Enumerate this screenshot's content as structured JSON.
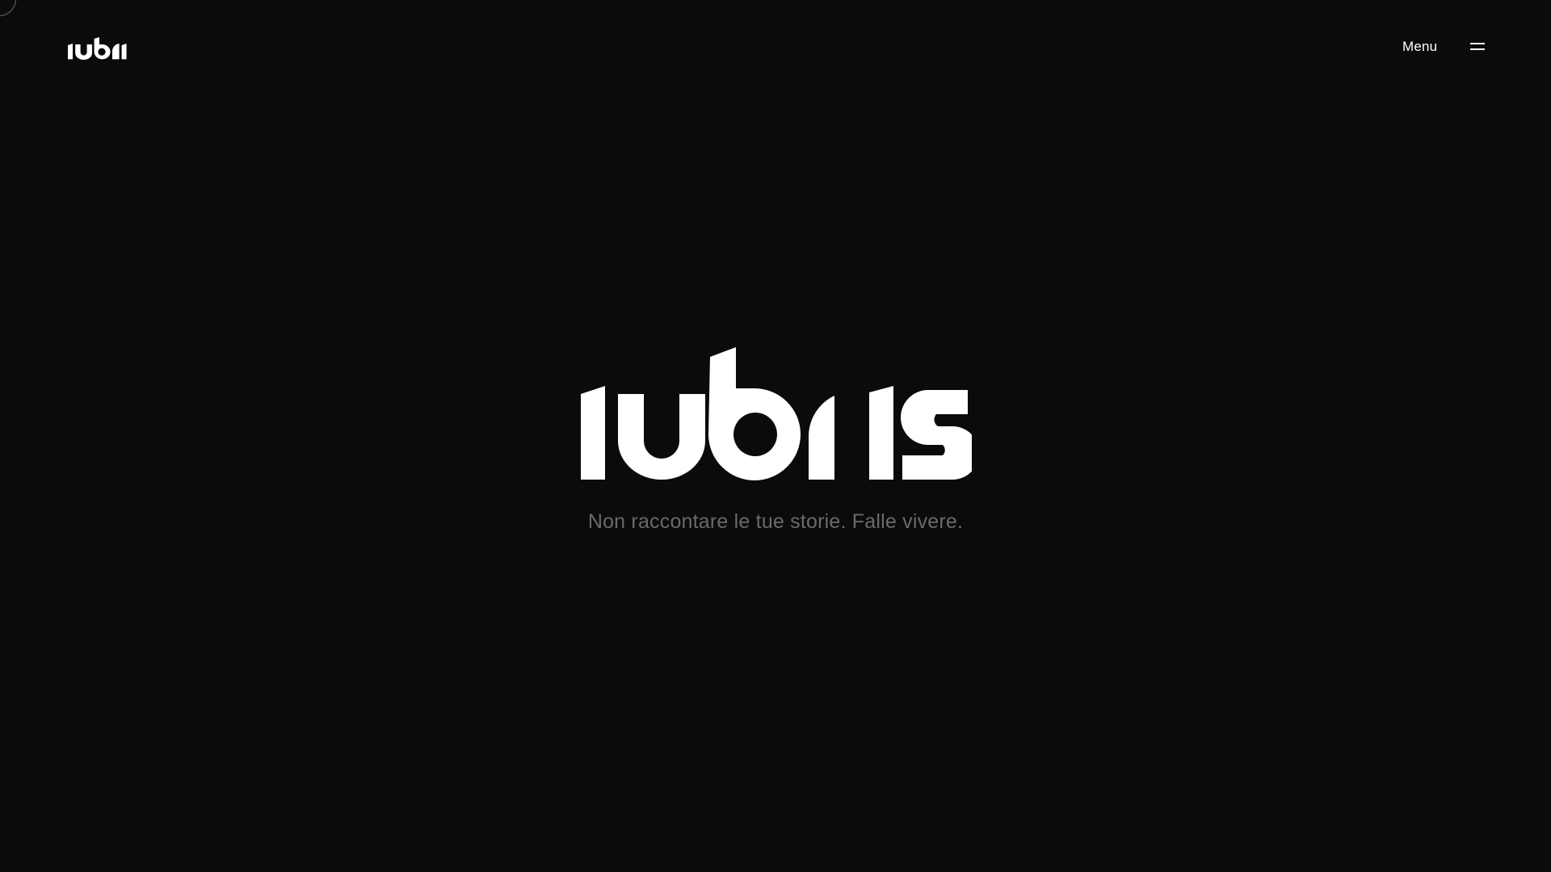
{
  "header": {
    "brand_name": "iubris",
    "menu_label": "Menu",
    "menu_icon": "hamburger-icon"
  },
  "hero": {
    "brand_name": "iubris",
    "tagline": "Non raccontare le tue storie. Falle vivere."
  },
  "colors": {
    "background": "#0b0b0b",
    "foreground": "#ffffff",
    "tagline": "#6a6a6a"
  }
}
